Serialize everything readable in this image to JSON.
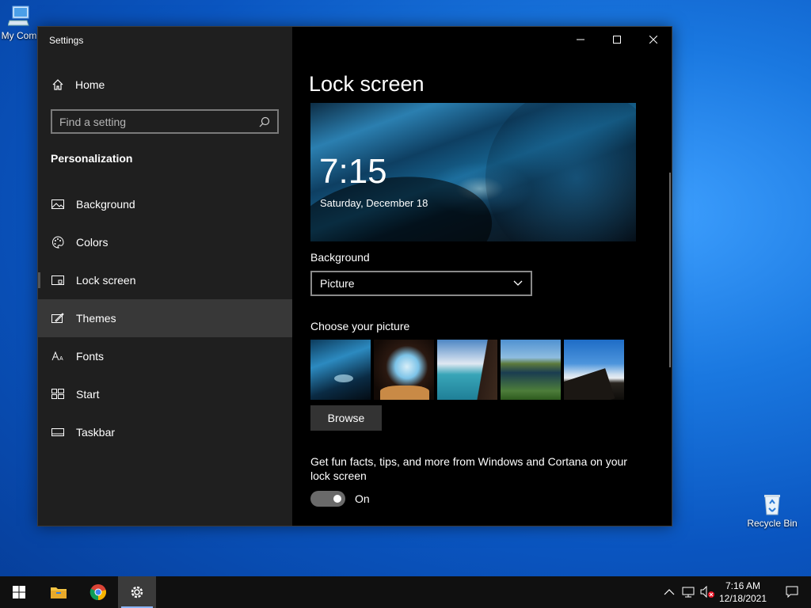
{
  "desktop": {
    "icons": [
      {
        "label": "My Com",
        "icon": "computer-icon"
      },
      {
        "label": "Recycle Bin",
        "icon": "recycle-bin-icon"
      }
    ]
  },
  "window": {
    "title": "Settings",
    "controls": {
      "minimize": "minimize-icon",
      "maximize": "maximize-icon",
      "close": "close-icon"
    }
  },
  "sidebar": {
    "home_label": "Home",
    "search_placeholder": "Find a setting",
    "section_title": "Personalization",
    "items": [
      {
        "label": "Background",
        "icon": "picture-icon"
      },
      {
        "label": "Colors",
        "icon": "palette-icon"
      },
      {
        "label": "Lock screen",
        "icon": "lock-screen-icon"
      },
      {
        "label": "Themes",
        "icon": "themes-icon"
      },
      {
        "label": "Fonts",
        "icon": "fonts-icon"
      },
      {
        "label": "Start",
        "icon": "start-icon"
      },
      {
        "label": "Taskbar",
        "icon": "taskbar-icon"
      }
    ],
    "selected": "Lock screen",
    "hovered": "Themes"
  },
  "content": {
    "page_title": "Lock screen",
    "preview": {
      "time": "7:15",
      "date": "Saturday, December 18"
    },
    "background_label": "Background",
    "background_value": "Picture",
    "choose_picture_label": "Choose your picture",
    "browse_label": "Browse",
    "tips_text": "Get fun facts, tips, and more from Windows and Cortana on your lock screen",
    "toggle_state": "On",
    "toggle_on": true
  },
  "taskbar": {
    "apps": [
      "start-icon",
      "file-explorer-icon",
      "chrome-icon",
      "settings-icon"
    ],
    "active_app": "settings-icon",
    "tray_icons": [
      "chevron-up-icon",
      "network-icon",
      "volume-muted-icon"
    ],
    "time": "7:16 AM",
    "date": "12/18/2021",
    "notification_icon": "action-center-icon"
  },
  "colors": {
    "window_bg": "#000000",
    "sidebar_bg": "#1f1f1f",
    "hover_bg": "#383838",
    "taskbar_bg": "#101010",
    "toggle_bg": "#6a6a6a"
  }
}
